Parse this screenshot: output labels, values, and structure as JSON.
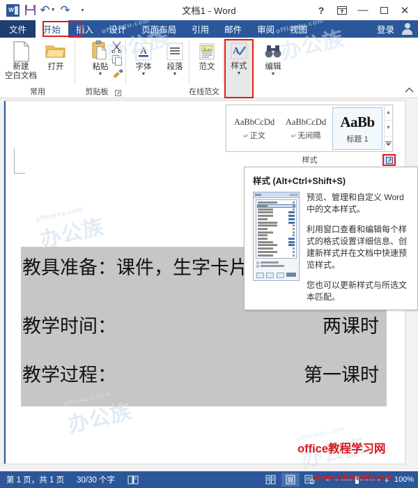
{
  "titlebar": {
    "document_title": "文档1 - Word",
    "quick_access": [
      {
        "name": "word-logo",
        "label": "W"
      },
      {
        "name": "save",
        "label": "保存"
      },
      {
        "name": "undo",
        "label": "撤消"
      },
      {
        "name": "redo",
        "label": "恢复"
      },
      {
        "name": "customize-qat",
        "label": "自定义快速访问工具栏"
      }
    ],
    "window_controls": [
      {
        "name": "help",
        "glyph": "?"
      },
      {
        "name": "ribbon-display-options",
        "glyph": "▣"
      },
      {
        "name": "minimize",
        "glyph": "—"
      },
      {
        "name": "restore",
        "glyph": "□"
      },
      {
        "name": "close",
        "glyph": "✕"
      }
    ]
  },
  "tabs": {
    "items": [
      {
        "label": "文件",
        "state": "file"
      },
      {
        "label": "开始",
        "state": "active"
      },
      {
        "label": "插入",
        "state": "normal"
      },
      {
        "label": "设计",
        "state": "normal"
      },
      {
        "label": "页面布局",
        "state": "normal"
      },
      {
        "label": "引用",
        "state": "normal"
      },
      {
        "label": "邮件",
        "state": "normal"
      },
      {
        "label": "审阅",
        "state": "normal"
      },
      {
        "label": "视图",
        "state": "normal"
      }
    ],
    "signin_label": "登录"
  },
  "ribbon": {
    "groups": [
      {
        "label": "常用",
        "has_launcher": false
      },
      {
        "label": "剪贴板",
        "has_launcher": true
      },
      {
        "label": "在线范文",
        "has_launcher": false
      },
      {
        "label": "样式",
        "has_launcher": true
      }
    ],
    "buttons": {
      "new_blank_doc": {
        "line1": "新建",
        "line2": "空白文档"
      },
      "open": "打开",
      "paste": "粘贴",
      "font": "字体",
      "paragraph": "段落",
      "sample_text": "范文",
      "styles": "样式",
      "editing": "编辑"
    },
    "collapse_label": "折叠功能区"
  },
  "style_gallery": {
    "items": [
      {
        "sample": "AaBbCcDd",
        "name": "正文",
        "selected": false,
        "pilcrow": "↵"
      },
      {
        "sample": "AaBbCcDd",
        "name": "无间隔",
        "selected": false,
        "pilcrow": "↵"
      },
      {
        "sample": "AaBb",
        "name": "标题 1",
        "selected": true,
        "pilcrow": ""
      }
    ],
    "group_label": "样式",
    "nav": [
      {
        "name": "scroll-up",
        "glyph": "▲"
      },
      {
        "name": "scroll-down",
        "glyph": "▼"
      },
      {
        "name": "more-styles",
        "glyph": "▼"
      }
    ]
  },
  "tooltip": {
    "title": "样式 (Alt+Ctrl+Shift+S)",
    "paragraphs": [
      "预览、管理和自定义 Word 中的文本样式。",
      "利用窗口查看和编辑每个样式的格式设置详细信息、创建新样式并在文档中快速预览样式。",
      "您也可以更新样式与所选文本匹配。"
    ]
  },
  "document": {
    "lines": [
      {
        "left": "教具准备：课件，生字卡片",
        "right": ""
      },
      {
        "left": "教学时间：",
        "right": "两课时"
      },
      {
        "left": "教学过程：",
        "right": "第一课时"
      }
    ]
  },
  "watermarks": {
    "blue_big": "办公族",
    "blue_small": "officezu.com",
    "red_title": "office教程学习网",
    "red_url": "www.office68.com"
  },
  "statusbar": {
    "page_info": "第 1 页，共 1 页",
    "word_count": "30/30 个字",
    "proofing_label": "校对",
    "views": [
      {
        "name": "read-mode",
        "active": false
      },
      {
        "name": "print-layout",
        "active": true
      },
      {
        "name": "web-layout",
        "active": false
      }
    ],
    "zoom_out": "−",
    "zoom_in": "+",
    "zoom_value": "100%"
  },
  "colors": {
    "word_blue": "#2b579a",
    "file_tab_blue": "#1e3f6f",
    "highlight_red": "#e01b1b",
    "selection_gray": "#c6c6c6",
    "watermark_blue": "#cfe0f0",
    "watermark_red": "#d61a1a"
  }
}
